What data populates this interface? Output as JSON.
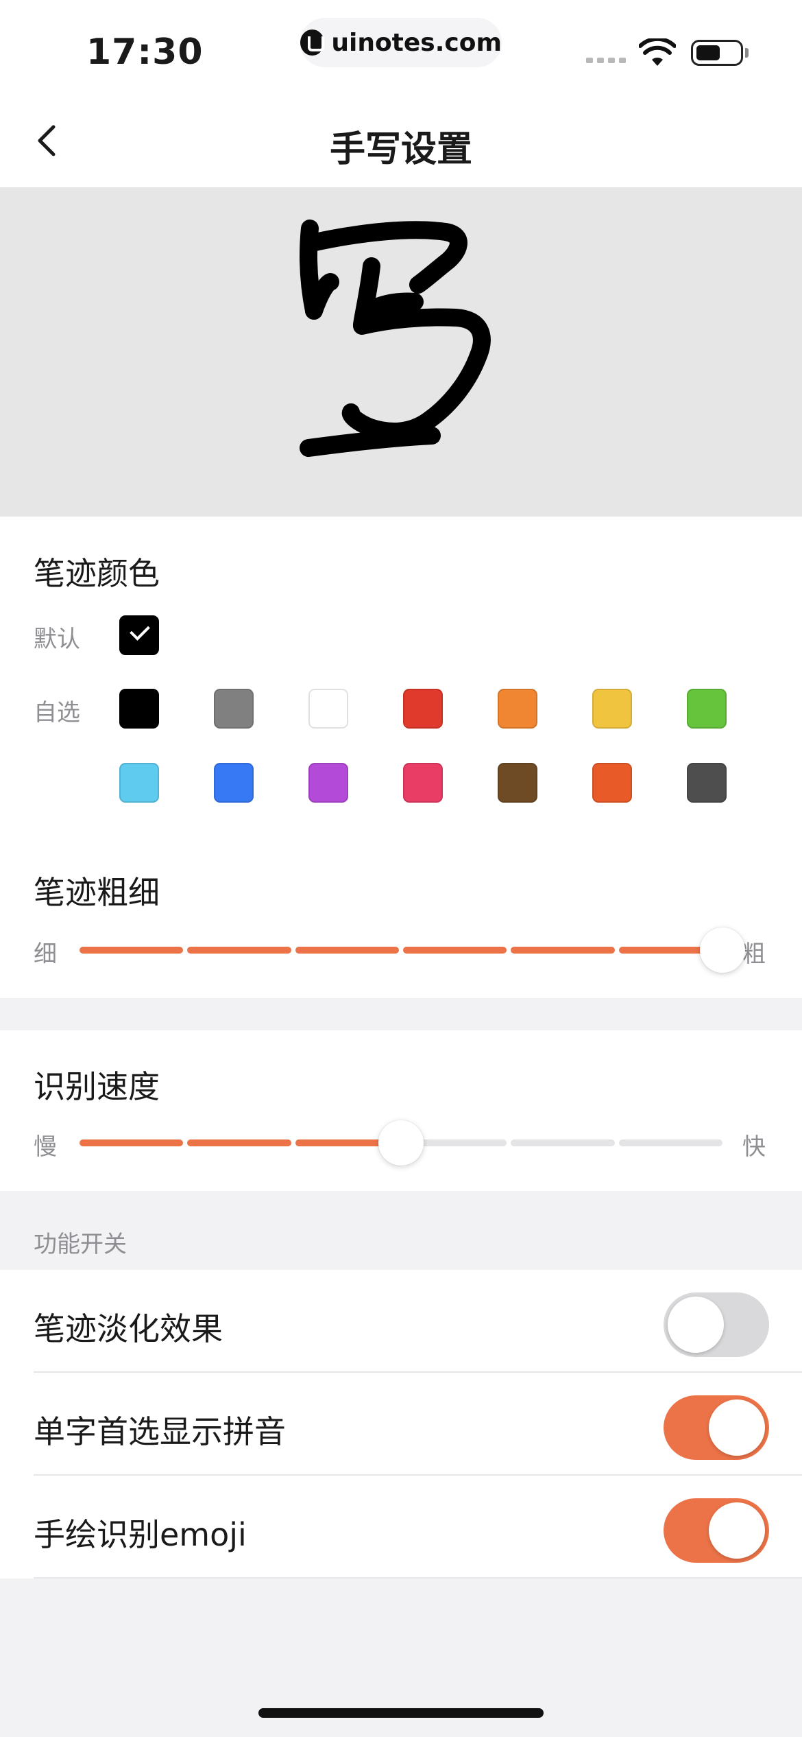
{
  "status_bar": {
    "time": "17:30",
    "url": "uinotes.com"
  },
  "nav": {
    "title": "手写设置"
  },
  "preview": {
    "char": "写"
  },
  "stroke_color": {
    "title": "笔迹颜色",
    "default_label": "默认",
    "custom_label": "自选",
    "default_swatch": "#000000",
    "selected": "default",
    "custom_row1": [
      "#000000",
      "#808080",
      "#ffffff",
      "#e03a2c",
      "#f08631",
      "#f0c43f",
      "#66c33c"
    ],
    "custom_row2": [
      "#5ecbef",
      "#3779f5",
      "#b44ad8",
      "#e93d66",
      "#6e4b25",
      "#e85b28",
      "#4e4e4e"
    ]
  },
  "stroke_width": {
    "title": "笔迹粗细",
    "min_label": "细",
    "max_label": "粗",
    "level": 1.0,
    "steps": 6
  },
  "recognition_speed": {
    "title": "识别速度",
    "min_label": "慢",
    "max_label": "快",
    "level": 0.5,
    "steps": 6
  },
  "features": {
    "caption": "功能开关",
    "items": [
      {
        "label": "笔迹淡化效果",
        "on": false
      },
      {
        "label": "单字首选显示拼音",
        "on": true
      },
      {
        "label": "手绘识别emoji",
        "on": true
      }
    ]
  },
  "colors": {
    "accent": "#ec7348",
    "track_off": "#e4e4e6"
  }
}
